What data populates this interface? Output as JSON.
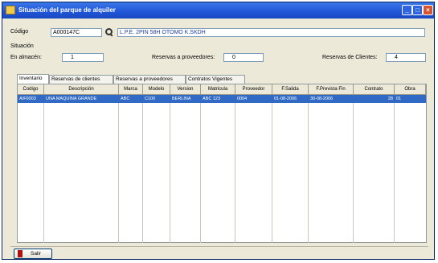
{
  "window": {
    "title": "Situación del parque de alquiler",
    "controls": [
      "minimize-icon",
      "maximize-icon",
      "close-icon"
    ]
  },
  "codigo": {
    "label": "Código",
    "value": "A000147C",
    "description": "L.P.E. 2PIN 58H OTOMO K.SKDH"
  },
  "situacion": {
    "label": "Situación",
    "en_almacen_label": "En almacén:",
    "en_almacen_value": "1",
    "reservas_proveedores_label": "Reservas a proveedores:",
    "reservas_proveedores_value": "0",
    "reservas_clientes_label": "Reservas de Clientes:",
    "reservas_clientes_value": "4"
  },
  "tabs": [
    {
      "label": "Inventario",
      "active": true
    },
    {
      "label": "Reservas de clientes",
      "active": false
    },
    {
      "label": "Reservas a proveedores",
      "active": false
    },
    {
      "label": "Contratos Vigentes",
      "active": false
    }
  ],
  "table": {
    "columns": [
      "Codigo",
      "Descripción",
      "Marca",
      "Modelo",
      "Version",
      "Matricula",
      "Proveedor",
      "F.Salida",
      "F.Prevista Fin",
      "Contrato",
      "Obra"
    ],
    "rows": [
      [
        "A/F0003",
        "UNA MAQUINA GRANDE",
        "ABC",
        "C100",
        "BERLINA",
        "ABC 123",
        "0004",
        "01-08-2006",
        "30-08-2006",
        "28",
        "01"
      ]
    ],
    "selected_row_color": "#316ac5"
  },
  "footer": {
    "exit_label": "Salir",
    "exit_icon": "exit-door-icon"
  }
}
